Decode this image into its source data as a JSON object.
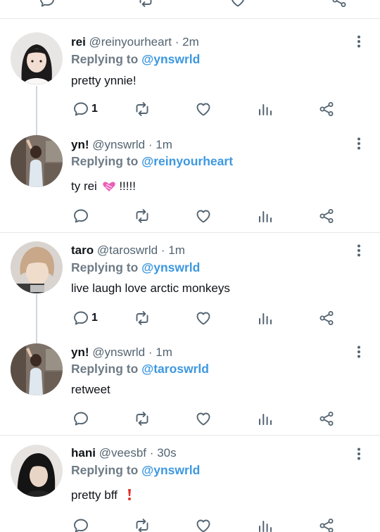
{
  "colors": {
    "accent": "#3d98e0",
    "muted": "#536471",
    "reply_label": "#6e7b86",
    "icon": "#536471",
    "heart_emoji": "#e85fb8",
    "exclaim": "#e0332a",
    "divider": "#e6e8ea"
  },
  "icons": [
    "reply-icon",
    "retweet-icon",
    "like-icon",
    "views-icon",
    "share-icon",
    "more-icon"
  ],
  "tweets": [
    {
      "name": "rei",
      "handle": "@reinyourheart",
      "dot": "·",
      "time": "2m",
      "replying_prefix": "Replying to",
      "replying_to": "@ynswrld",
      "text": "pretty ynnie!",
      "reply_count": "1"
    },
    {
      "name": "yn!",
      "handle": "@ynswrld",
      "dot": "·",
      "time": "1m",
      "replying_prefix": "Replying to",
      "replying_to": "@reinyourheart",
      "text": "ty rei",
      "text_after": "!!!!!",
      "emoji": "heart-emoji",
      "reply_count": ""
    },
    {
      "name": "taro",
      "handle": "@taroswrld",
      "dot": "·",
      "time": "1m",
      "replying_prefix": "Replying to",
      "replying_to": "@ynswrld",
      "text": "live laugh love arctic monkeys",
      "reply_count": "1"
    },
    {
      "name": "yn!",
      "handle": "@ynswrld",
      "dot": "·",
      "time": "1m",
      "replying_prefix": "Replying to",
      "replying_to": "@taroswrld",
      "text": "retweet",
      "reply_count": ""
    },
    {
      "name": "hani",
      "handle": "@veesbf",
      "dot": "·",
      "time": "30s",
      "replying_prefix": "Replying to",
      "replying_to": "@ynswrld",
      "text": "pretty bff",
      "emoji": "exclamation-emoji",
      "reply_count": ""
    }
  ]
}
